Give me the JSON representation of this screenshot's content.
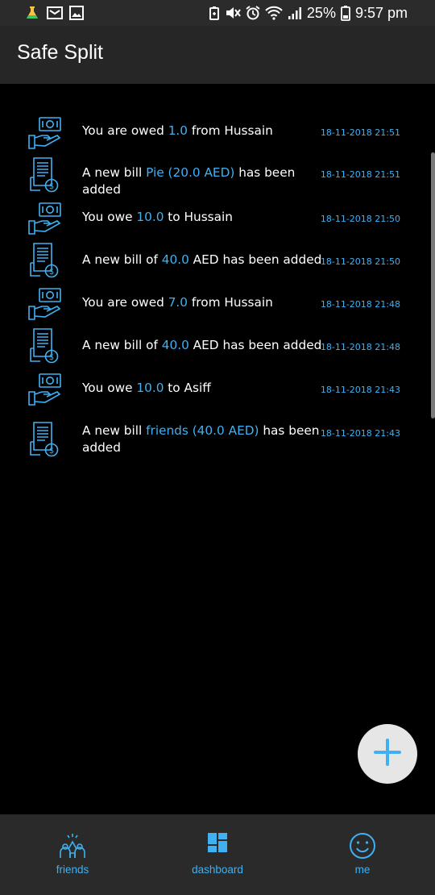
{
  "status_bar": {
    "battery_percent": "25%",
    "time": "9:57 pm",
    "left_icons": [
      "flask-icon",
      "message-icon",
      "image-icon"
    ],
    "right_icons": [
      "battery-saver-icon",
      "mute-icon",
      "alarm-icon",
      "wifi-icon",
      "signal-icon",
      "battery-icon"
    ]
  },
  "app_bar": {
    "title": "Safe Split"
  },
  "colors": {
    "accent": "#3fb1f3",
    "background": "#000000",
    "bar": "#262626"
  },
  "notifications": [
    {
      "icon": "cash-hand-icon",
      "pre": "You are owed ",
      "hl": "1.0",
      "post": " from Hussain",
      "time": "18-11-2018 21:51"
    },
    {
      "icon": "bill-receipt-icon",
      "pre": "A new bill ",
      "hl": "Pie (20.0 AED)",
      "post": " has been added",
      "time": "18-11-2018 21:51"
    },
    {
      "icon": "cash-hand-icon",
      "pre": "You owe ",
      "hl": "10.0",
      "post": " to Hussain",
      "time": "18-11-2018 21:50"
    },
    {
      "icon": "bill-receipt-icon",
      "pre": "A new bill of ",
      "hl": "40.0",
      "post": " AED has been added",
      "time": "18-11-2018 21:50"
    },
    {
      "icon": "cash-hand-icon",
      "pre": "You are owed ",
      "hl": "7.0",
      "post": " from Hussain",
      "time": "18-11-2018 21:48"
    },
    {
      "icon": "bill-receipt-icon",
      "pre": "A new bill of ",
      "hl": "40.0",
      "post": " AED has been added",
      "time": "18-11-2018 21:48"
    },
    {
      "icon": "cash-hand-icon",
      "pre": "You owe ",
      "hl": "10.0",
      "post": " to Asiff",
      "time": "18-11-2018 21:43"
    },
    {
      "icon": "bill-receipt-icon",
      "pre": "A new bill ",
      "hl": "friends (40.0 AED)",
      "post": " has been added",
      "time": "18-11-2018 21:43"
    }
  ],
  "fab": {
    "icon": "plus-icon"
  },
  "bottom_nav": [
    {
      "label": "friends",
      "icon": "friends-icon"
    },
    {
      "label": "dashboard",
      "icon": "dashboard-icon"
    },
    {
      "label": "me",
      "icon": "smiley-icon"
    }
  ]
}
